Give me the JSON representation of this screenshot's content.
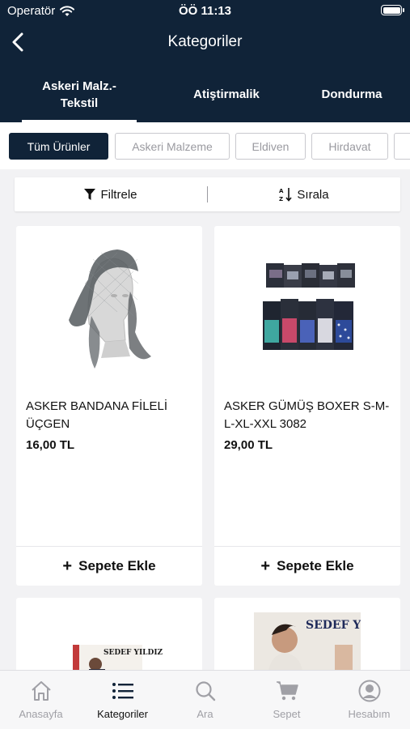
{
  "status": {
    "carrier": "Operatör",
    "time": "ÖÖ 11:13"
  },
  "nav": {
    "title": "Kategoriler"
  },
  "categories": [
    {
      "label": "Askeri Malz.-\nTekstil",
      "active": true
    },
    {
      "label": "Atiştirmalik",
      "active": false
    },
    {
      "label": "Dondurma",
      "active": false
    }
  ],
  "chips": [
    "Tüm Ürünler",
    "Askeri Malzeme",
    "Eldiven",
    "Hirdavat",
    ""
  ],
  "sort": {
    "filter_label": "Filtrele",
    "sort_label": "Sırala"
  },
  "products": [
    {
      "name": "ASKER BANDANA FİLELİ ÜÇGEN",
      "price": "16,00 TL",
      "add_label": "Sepete Ekle",
      "image": "bandana-mannequin"
    },
    {
      "name": "ASKER GÜMÜŞ BOXER S-M-L-XL-XXL 3082",
      "price": "29,00 TL",
      "add_label": "Sepete Ekle",
      "image": "boxer-packs"
    },
    {
      "name": "",
      "price": "",
      "add_label": "",
      "image": "sedef-yildiz-pack",
      "brand": "SEDEF YILDIZ"
    },
    {
      "name": "",
      "price": "",
      "add_label": "",
      "image": "sedef-yildiz-model",
      "brand": "SEDEF YILDIZ"
    }
  ],
  "tabbar": [
    {
      "label": "Anasayfa",
      "icon": "home-icon",
      "active": false
    },
    {
      "label": "Kategoriler",
      "icon": "list-icon",
      "active": true
    },
    {
      "label": "Ara",
      "icon": "search-icon",
      "active": false
    },
    {
      "label": "Sepet",
      "icon": "cart-icon",
      "active": false
    },
    {
      "label": "Hesabım",
      "icon": "account-icon",
      "active": false
    }
  ],
  "colors": {
    "header": "#102338",
    "background": "#f2f2f4",
    "inactive_text": "#a0a0a6"
  }
}
